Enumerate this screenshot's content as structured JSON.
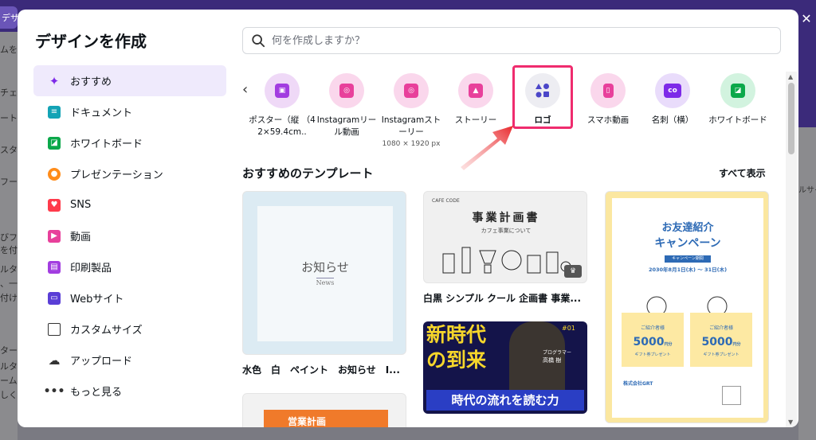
{
  "modal": {
    "title": "デザインを作成",
    "search_placeholder": "何を作成しますか？"
  },
  "sidebar": {
    "items": [
      {
        "label": "おすすめ",
        "icon": "sparkle-icon",
        "color": "#7d2ae8"
      },
      {
        "label": "ドキュメント",
        "icon": "document-icon",
        "color": "#13a3b5"
      },
      {
        "label": "ホワイトボード",
        "icon": "whiteboard-icon",
        "color": "#0ba84a"
      },
      {
        "label": "プレゼンテーション",
        "icon": "presentation-icon",
        "color": "#ff8c1a"
      },
      {
        "label": "SNS",
        "icon": "heart-icon",
        "color": "#ff3b4b"
      },
      {
        "label": "動画",
        "icon": "video-icon",
        "color": "#e8409b"
      },
      {
        "label": "印刷製品",
        "icon": "printer-icon",
        "color": "#a23de0"
      },
      {
        "label": "Webサイト",
        "icon": "website-icon",
        "color": "#5a3ed6"
      },
      {
        "label": "カスタムサイズ",
        "icon": "custom-size-icon",
        "color": "#333333"
      },
      {
        "label": "アップロード",
        "icon": "upload-icon",
        "color": "#333333"
      },
      {
        "label": "もっと見る",
        "icon": "more-icon",
        "color": "#333333"
      }
    ]
  },
  "categories": [
    {
      "label": "ポスター（縦 （42×59.4cm..",
      "sub": "",
      "icon": "poster-icon",
      "bg": "#efd9f7",
      "fg": "#a23de0"
    },
    {
      "label": "Instagramリール動画",
      "sub": "",
      "icon": "instagram-reel-icon",
      "bg": "#fad7ec",
      "fg": "#e8409b"
    },
    {
      "label": "Instagramストーリー",
      "sub": "1080 × 1920 px",
      "icon": "instagram-story-icon",
      "bg": "#fad7ec",
      "fg": "#e8409b"
    },
    {
      "label": "ストーリー",
      "sub": "",
      "icon": "story-icon",
      "bg": "#fad7ec",
      "fg": "#e8409b"
    },
    {
      "label": "ロゴ",
      "sub": "",
      "icon": "logo-shapes-icon",
      "bg": "#ededf2",
      "fg": "#4b46c8"
    },
    {
      "label": "スマホ動画",
      "sub": "",
      "icon": "phone-video-icon",
      "bg": "#fad7ec",
      "fg": "#e8409b"
    },
    {
      "label": "名刺（横）",
      "sub": "",
      "icon": "business-card-icon",
      "bg": "#e9dcfb",
      "fg": "#7d2ae8"
    },
    {
      "label": "ホワイトボード",
      "sub": "",
      "icon": "whiteboard-icon",
      "bg": "#d2f3df",
      "fg": "#0ba84a"
    }
  ],
  "templates": {
    "section_title": "おすすめのテンプレート",
    "see_all": "すべて表示",
    "items": [
      {
        "label": "水色　白　ペイント　お知らせ　I...",
        "inner_title": "お知らせ",
        "inner_sub": "News"
      },
      {
        "label": "白黒 シンプル クール 企画書 事業...",
        "inner_brand": "CAFE CODE",
        "inner_title": "事業計画書",
        "inner_sub": "カフェ事業について"
      },
      {
        "label": "",
        "inner_line1": "新時代",
        "inner_line2": "の到来",
        "inner_bottom": "時代の流れを読む力",
        "inner_tag": "#01",
        "inner_role": "プログラマー",
        "inner_name": "高橋 樹"
      },
      {
        "label": "",
        "inner_title": "お友達紹介",
        "inner_title2": "キャンペーン",
        "inner_badge": "キャンペーン期間",
        "inner_date": "2030年8月1日(木) ～ 31日(木)",
        "inner_left_label": "ご紹介者様",
        "inner_right_label": "ご紹介者様",
        "inner_left_value": "5000",
        "inner_right_value": "5000",
        "inner_unit": "円分",
        "inner_gift": "ギフト券プレゼント",
        "inner_company": "株式会社GRT"
      },
      {
        "label": "",
        "inner_title": "営業計画"
      }
    ]
  },
  "background": {
    "left_items": [
      "デザイン",
      "ムを",
      "チェ",
      "ート",
      "スタ",
      "フー",
      "びフ",
      "を付",
      "ルタ",
      "、一",
      "付け",
      "ターを",
      "ルタ",
      "ームの",
      "しく"
    ],
    "right_text": "ルサイ"
  },
  "colors": {
    "accent": "#7d2ae8",
    "highlight": "#ef2c6e",
    "sidebar_active_bg": "#efeafc"
  }
}
